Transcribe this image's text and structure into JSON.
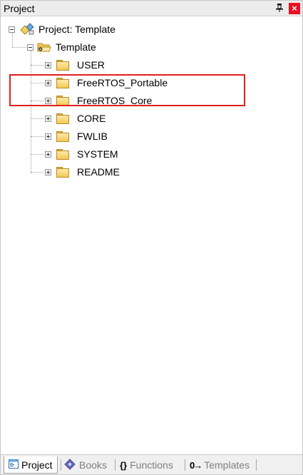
{
  "panel": {
    "title": "Project",
    "pin_glyph": "†",
    "close_glyph": "×"
  },
  "tree": {
    "project_label": "Project: Template",
    "target_label": "Template",
    "groups": [
      {
        "label": "USER"
      },
      {
        "label": "FreeRTOS_Portable"
      },
      {
        "label": "FreeRTOS_Core"
      },
      {
        "label": "CORE"
      },
      {
        "label": "FWLIB"
      },
      {
        "label": "SYSTEM"
      },
      {
        "label": "README"
      }
    ],
    "highlight_color": "#e02020"
  },
  "tabs": [
    {
      "label": "Project",
      "icon": "project-icon",
      "active": true
    },
    {
      "label": "Books",
      "icon": "books-icon",
      "active": false
    },
    {
      "label": "Functions",
      "icon": "functions-icon",
      "glyph": "{}",
      "active": false
    },
    {
      "label": "Templates",
      "icon": "templates-icon",
      "glyph": "0→",
      "active": false
    }
  ]
}
